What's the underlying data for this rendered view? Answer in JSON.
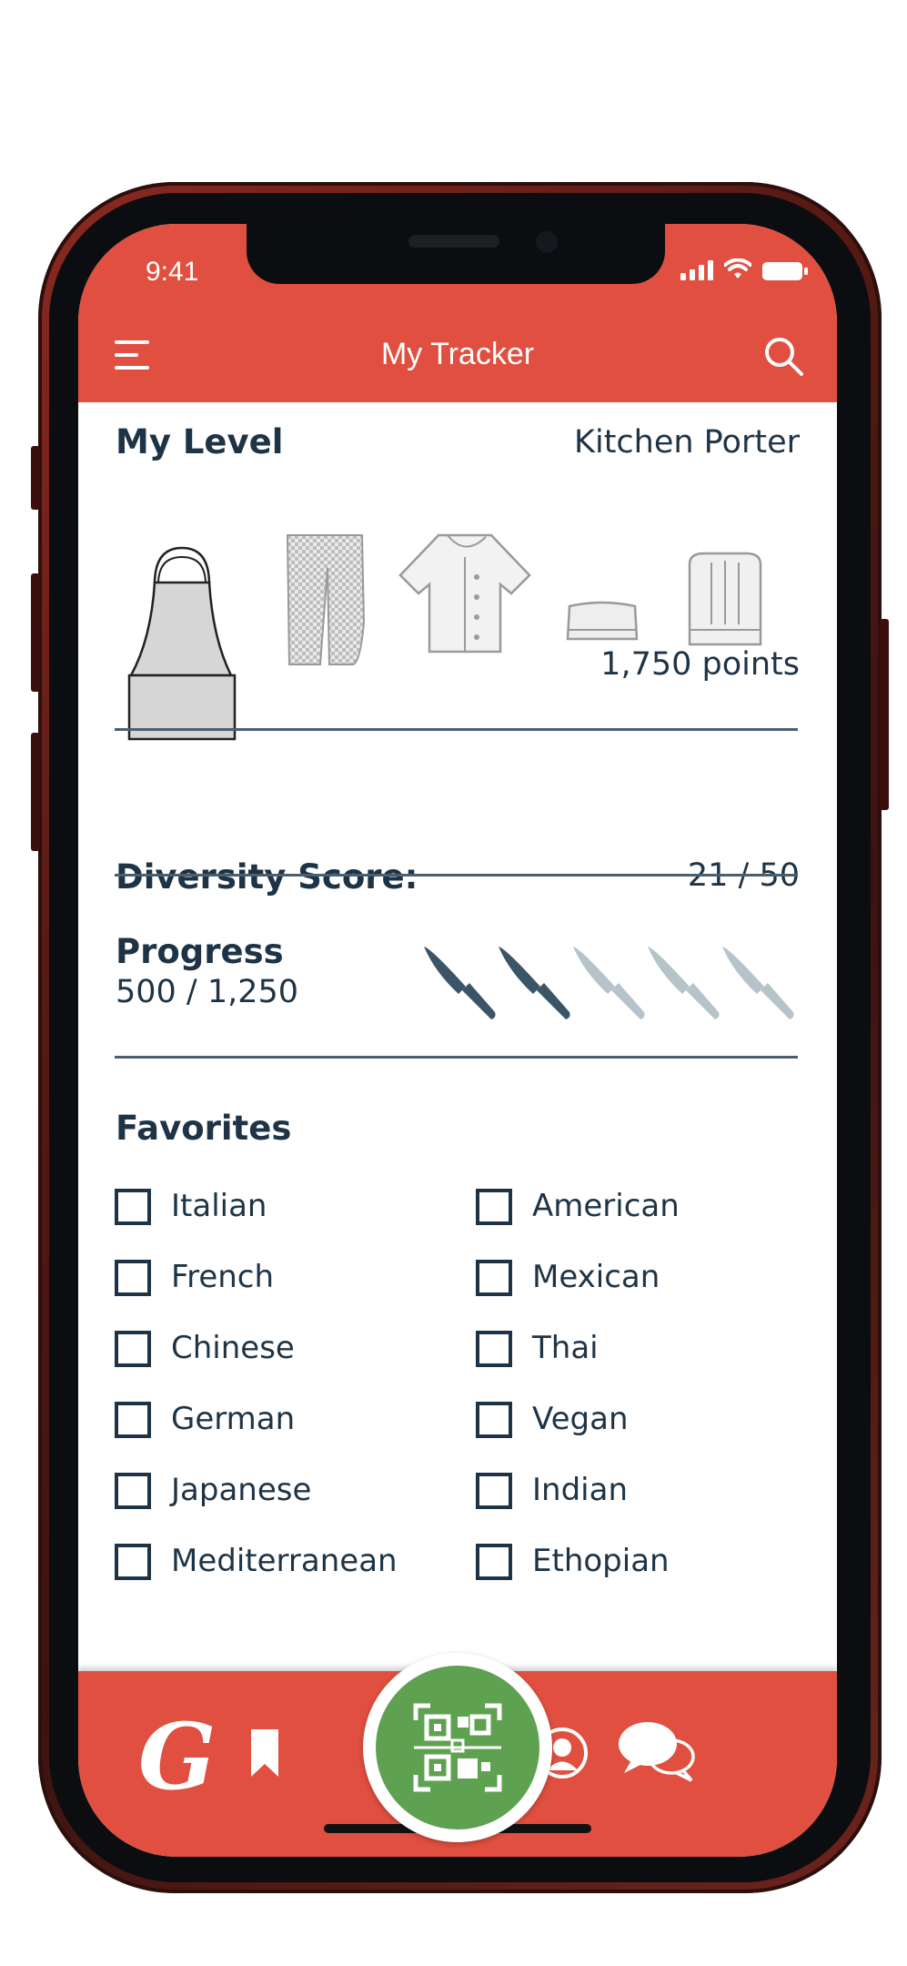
{
  "status_bar": {
    "time": "9:41"
  },
  "header": {
    "title": "My Tracker",
    "menu_icon": "hamburger-menu-icon",
    "search_icon": "search-icon"
  },
  "level": {
    "title": "My Level",
    "value": "Kitchen Porter",
    "points": "1,750 points",
    "garments": [
      "apron-icon",
      "pants-icon",
      "chef-jacket-icon",
      "small-hat-icon",
      "chef-toque-icon"
    ]
  },
  "diversity": {
    "title": "Diversity Score:",
    "value": "21 / 50"
  },
  "progress": {
    "title": "Progress",
    "value": "500 / 1,250",
    "knives_total": 5,
    "knives_filled": 2
  },
  "favorites": {
    "title": "Favorites",
    "left": [
      "Italian",
      "French",
      "Chinese",
      "German",
      "Japanese",
      "Mediterranean"
    ],
    "right": [
      "American",
      "Mexican",
      "Thai",
      "Vegan",
      "Indian",
      "Ethopian"
    ]
  },
  "bottom_nav": {
    "brand_letter": "G",
    "items": [
      "bookmark-icon",
      "qr-scan-icon",
      "profile-icon",
      "chat-icon"
    ]
  },
  "colors": {
    "brand_red": "#e04f3f",
    "navy": "#1e3446",
    "scan_green": "#5ea151",
    "knife_dark": "#3a5568",
    "knife_light": "#b7c3cb"
  }
}
